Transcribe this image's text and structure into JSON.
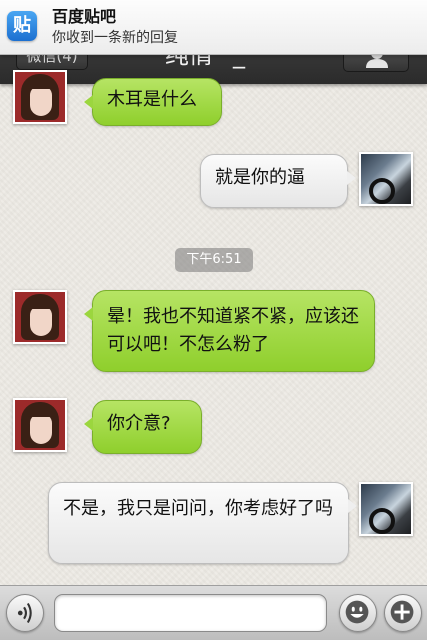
{
  "notification": {
    "app_icon_char": "贴",
    "title": "百度贴吧",
    "body": "你收到一条新的回复"
  },
  "navbar": {
    "back_label": "微信(4)",
    "title": "纯情^_^"
  },
  "messages": [
    {
      "from": "other",
      "text": "木耳是什么"
    },
    {
      "from": "me",
      "text": "就是你的逼"
    },
    {
      "from": "other",
      "text": "晕！我也不知道紧不紧，应该还可以吧！不怎么粉了"
    },
    {
      "from": "other",
      "text": "你介意?"
    },
    {
      "from": "me",
      "text": "不是，我只是问问，你考虑好了吗"
    }
  ],
  "timestamp": "下午6:51",
  "input": {
    "value": "",
    "placeholder": ""
  },
  "colors": {
    "incoming_bubble": "#a6dc4c",
    "outgoing_bubble": "#f0f0f0",
    "navbar": "#333333"
  }
}
